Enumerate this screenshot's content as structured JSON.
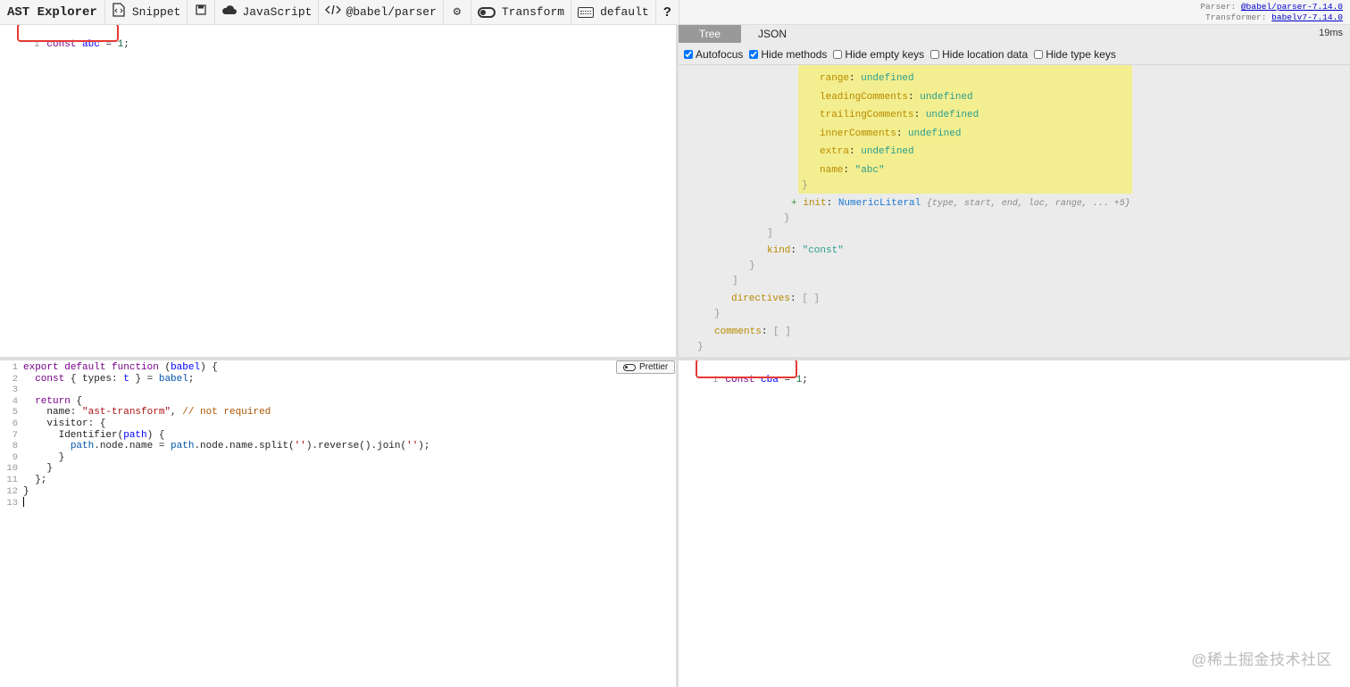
{
  "toolbar": {
    "title": "AST Explorer",
    "snippet_label": "Snippet",
    "language_label": "JavaScript",
    "parser_label": "@babel/parser",
    "transform_label": "Transform",
    "keymap_label": "default",
    "help_label": "?"
  },
  "parser_info": {
    "parser_prefix": "Parser:",
    "parser_link": "@babel/parser-7.14.0",
    "transformer_prefix": "Transformer:",
    "transformer_link": "babelv7-7.14.0"
  },
  "source": {
    "line_number": "1",
    "tokens": [
      "const",
      "abc",
      "=",
      "1",
      ";"
    ]
  },
  "ast": {
    "tabs": [
      "Tree",
      "JSON"
    ],
    "active_tab": "Tree",
    "time": "19ms",
    "options": [
      {
        "label": "Autofocus",
        "checked": true
      },
      {
        "label": "Hide methods",
        "checked": true
      },
      {
        "label": "Hide empty keys",
        "checked": false
      },
      {
        "label": "Hide location data",
        "checked": false
      },
      {
        "label": "Hide type keys",
        "checked": false
      }
    ],
    "identifier_fields": [
      {
        "key": "range",
        "value": "undefined"
      },
      {
        "key": "leadingComments",
        "value": "undefined"
      },
      {
        "key": "trailingComments",
        "value": "undefined"
      },
      {
        "key": "innerComments",
        "value": "undefined"
      },
      {
        "key": "extra",
        "value": "undefined"
      },
      {
        "key": "name",
        "value": "\"abc\""
      }
    ],
    "init_key": "init",
    "init_type": "NumericLiteral",
    "init_summary": "{type, start, end, loc, range, ... +5}",
    "kind_key": "kind",
    "kind_value": "\"const\"",
    "directives_key": "directives",
    "comments_key": "comments",
    "empty_array": "[ ]"
  },
  "transform": {
    "prettier_label": "Prettier",
    "line_numbers": [
      "1",
      "2",
      "3",
      "4",
      "5",
      "6",
      "7",
      "8",
      "9",
      "10",
      "11",
      "12",
      "13"
    ]
  },
  "output": {
    "line_number": "1",
    "tokens": [
      "const",
      "cba",
      "=",
      "1",
      ";"
    ]
  },
  "watermark": "@稀土掘金技术社区"
}
